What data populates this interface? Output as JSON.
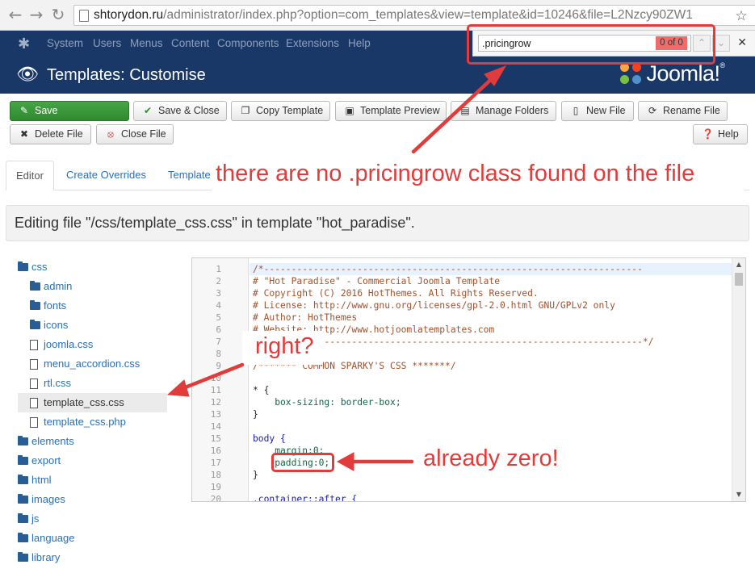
{
  "browser": {
    "back_icon": "arrow-left-icon",
    "forward_icon": "arrow-right-icon",
    "reload_icon": "reload-icon",
    "url_host": "shtorydon.ru",
    "url_rest": "/administrator/index.php?option=com_templates&view=template&id=10246&file=L2Nzcy90ZW1",
    "star_icon": "star-icon"
  },
  "findbar": {
    "query": ".pricingrow",
    "count": "0 of 0",
    "prev_icon": "chevron-up-icon",
    "next_icon": "chevron-down-icon",
    "close_icon": "close-icon"
  },
  "adminmenu": {
    "items": [
      "System",
      "Users",
      "Menus",
      "Content",
      "Components",
      "Extensions",
      "Help"
    ]
  },
  "header": {
    "title": "Templates: Customise",
    "brand": "Joomla!",
    "brand_mark": "®"
  },
  "toolbar": {
    "save": "Save",
    "save_close": "Save & Close",
    "copy_template": "Copy Template",
    "template_preview": "Template Preview",
    "manage_folders": "Manage Folders",
    "new_file": "New File",
    "rename_file": "Rename File",
    "delete_file": "Delete File",
    "close_file": "Close File",
    "help": "Help"
  },
  "tabs": {
    "editor": "Editor",
    "create_overrides": "Create Overrides",
    "template": "Template"
  },
  "editing_message": "Editing file \"/css/template_css.css\" in template \"hot_paradise\".",
  "tree": {
    "folders_top": [
      "css"
    ],
    "css_children_folders": [
      "admin",
      "fonts",
      "icons"
    ],
    "css_children_files": [
      "joomla.css",
      "menu_accordion.css",
      "rtl.css",
      "template_css.css",
      "template_css.php"
    ],
    "folders_bottom": [
      "elements",
      "export",
      "html",
      "images",
      "js",
      "language",
      "library"
    ]
  },
  "code": {
    "line_numbers": [
      "1",
      "2",
      "3",
      "4",
      "5",
      "6",
      "7",
      "8",
      "9",
      "10",
      "11",
      "12",
      "13",
      "14",
      "15",
      "16",
      "17",
      "18",
      "19",
      "20"
    ],
    "lines": [
      "/*---------------------------------------------------------------------",
      "# \"Hot Paradise\" - Commercial Joomla Template",
      "# Copyright (C) 2016 HotThemes. All Rights Reserved.",
      "# License: http://www.gnu.org/licenses/gpl-2.0.html GNU/GPLv2 only",
      "# Author: HotThemes",
      "# Website: http://www.hotjoomlatemplates.com",
      "-----------------------------------------------------------------------*/",
      "",
      "/******* COMMON SPARKY'S CSS *******/",
      "",
      "* {",
      "    box-sizing: border-box;",
      "}",
      "",
      "body {",
      "    margin:0;",
      "    padding:0;",
      "}",
      "",
      ".container::after {"
    ]
  },
  "annotations": {
    "find_note": "there are no .pricingrow class found on the file",
    "tree_note": "right?",
    "code_note": "already zero!"
  },
  "colors": {
    "annotation_red": "#e23b3b",
    "admin_blue": "#1a3867",
    "save_green": "#46a546",
    "link_blue": "#2a6fb5"
  }
}
